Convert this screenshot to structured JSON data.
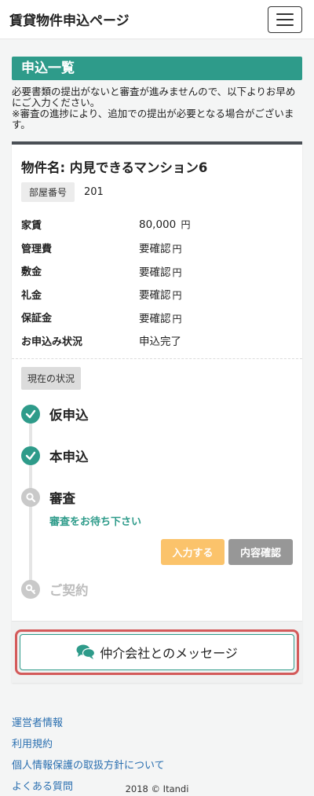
{
  "header": {
    "title": "賃貸物件申込ページ"
  },
  "section": {
    "title": "申込一覧",
    "notice_1": "必要書類の提出がないと審査が進みませんので、以下よりお早めにご入力ください。",
    "notice_2": "※審査の進捗により、追加での提出が必要となる場合がございます。"
  },
  "property": {
    "name": "物件名: 内見できるマンション6",
    "room_label": "部屋番号",
    "room_number": "201"
  },
  "info": [
    {
      "label": "家賃",
      "value": "80,000",
      "unit": "円"
    },
    {
      "label": "管理費",
      "value": "要確認",
      "unit": "円"
    },
    {
      "label": "敷金",
      "value": "要確認",
      "unit": "円"
    },
    {
      "label": "礼金",
      "value": "要確認",
      "unit": "円"
    },
    {
      "label": "保証金",
      "value": "要確認",
      "unit": "円"
    },
    {
      "label": "お申込み状況",
      "value": "申込完了",
      "unit": ""
    }
  ],
  "status": {
    "tag": "現在の状況",
    "steps": [
      {
        "label": "仮申込",
        "icon": "check-icon",
        "state": "done"
      },
      {
        "label": "本申込",
        "icon": "check-icon",
        "state": "done"
      },
      {
        "label": "審査",
        "icon": "search-icon",
        "state": "current"
      },
      {
        "label": "ご契約",
        "icon": "key-icon",
        "state": "pending"
      }
    ],
    "waiting_text": "審査をお待ち下さい",
    "btn_input": "入力する",
    "btn_confirm": "内容確認"
  },
  "message_button": {
    "label": "仲介会社とのメッセージ",
    "icon": "chat-icon"
  },
  "footer_links": [
    "運営者情報",
    "利用規約",
    "個人情報保護の取扱方針について",
    "よくある質問"
  ],
  "copyright": "2018 © Itandi",
  "colors": {
    "accent": "#2e9b8a",
    "warning": "#fbc36b",
    "muted": "#979797",
    "highlight": "#d35a5a",
    "link": "#2a6fb0"
  }
}
